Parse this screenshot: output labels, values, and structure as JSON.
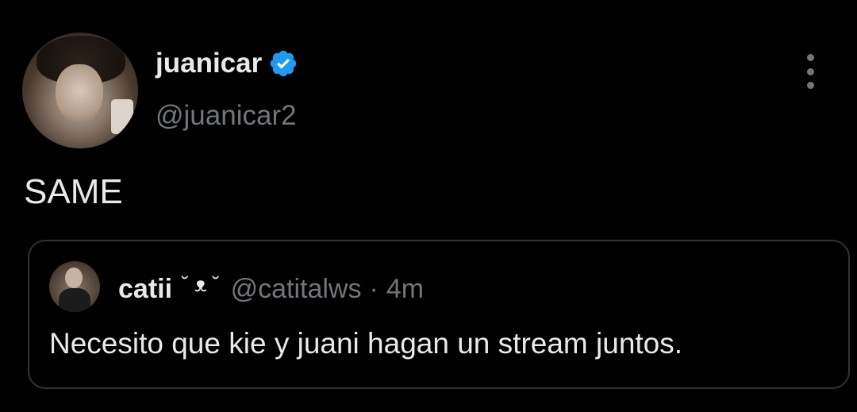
{
  "tweet": {
    "display_name": "juanicar",
    "handle": "@juanicar2",
    "text": "SAME",
    "verified_icon": "verified-badge-icon",
    "more_icon": "more-options-icon"
  },
  "quoted_tweet": {
    "display_name": "catii",
    "emoji": "˘ ᴥ ˘",
    "handle": "@catitalws",
    "separator": "·",
    "time": "4m",
    "text": "Necesito que kie y juani hagan un stream juntos."
  },
  "colors": {
    "background": "#000000",
    "primary_text": "#e7e9ea",
    "secondary_text": "#71767b",
    "border": "#2f3336",
    "verified_blue": "#1d9bf0"
  }
}
